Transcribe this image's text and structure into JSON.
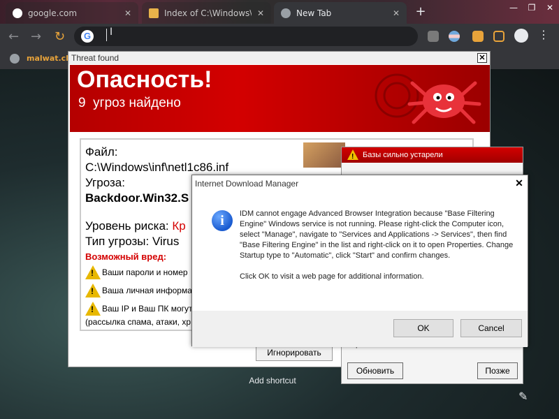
{
  "browser": {
    "tabs": [
      {
        "label": "google.com",
        "active": false
      },
      {
        "label": "Index of C:\\Windows\\",
        "active": false
      },
      {
        "label": "New Tab",
        "active": true
      }
    ],
    "new_tab_symbol": "+",
    "window_controls": [
      "—",
      "❐",
      "✕"
    ],
    "bookmark": "malwat.ch",
    "add_shortcut": "Add shortcut",
    "ibeam": "I"
  },
  "threat_window": {
    "title": "Threat found",
    "heading": "Опасность!",
    "threats_count": "9",
    "threats_text": "угроз найдено",
    "file_label": "Файл:",
    "file_path": "C:\\Windows\\inf\\netl1c86.inf",
    "threat_label": "Угроза:",
    "threat_name": "Backdoor.Win32.S",
    "risk_label": "Уровень риска:",
    "risk_value": "Кр",
    "type_label": "Тип угрозы:",
    "type_value": "Virus",
    "harm_title": "Возможный вред:",
    "harm_items": [
      "Ваши пароли и номер",
      "Ваша личная информа",
      "Ваш IP и Ваш ПК могут"
    ],
    "harm_extra": "(рассылка спама, атаки, хр",
    "ignore_button": "Игнорировать"
  },
  "outdated_window": {
    "title": "Базы сильно устарели",
    "body_text": "прямо сейчас?",
    "refresh_button": "Обновить",
    "later_button": "Позже"
  },
  "idm_dialog": {
    "title": "Internet Download Manager",
    "message": "IDM cannot engage Advanced Browser Integration because \"Base Filtering Engine\" Windows service is not running. Please right-click the Computer icon, select \"Manage\", navigate to \"Services and Applications -> Services\", then find \"Base Filtering Engine\" in the list and right-click on it to open Properties. Change Startup type to \"Automatic\", click \"Start\" and confirm changes.",
    "message2": "Click OK to visit a web page for additional information.",
    "ok_button": "OK",
    "cancel_button": "Cancel"
  },
  "colors": {
    "accent_red": "#d30000",
    "warning_yellow": "#e8b800",
    "chrome_dark": "#35363a",
    "bookmark_text": "#e8a33a"
  }
}
